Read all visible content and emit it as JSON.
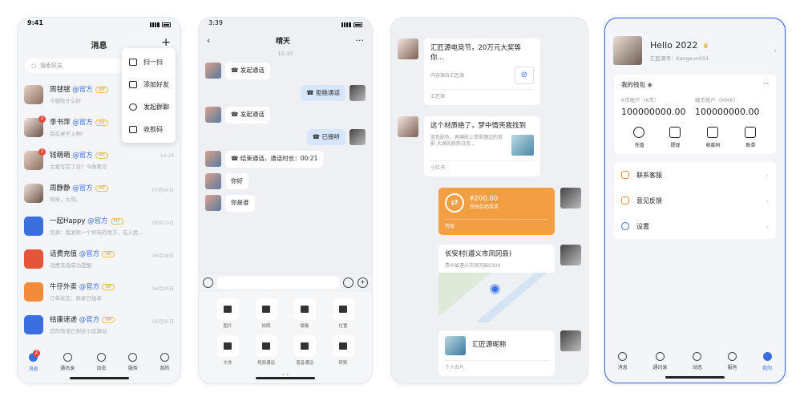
{
  "screen1": {
    "status_time": "9:41",
    "title": "消息",
    "search_placeholder": "搜索好友",
    "popup": [
      "扫一扫",
      "添加好友",
      "发起群聊",
      "收款码"
    ],
    "conversations": [
      {
        "name": "周毬毬",
        "official": "@官方",
        "vip": "VIP",
        "preview": "今晚吃什么好",
        "time": "",
        "badge": ""
      },
      {
        "name": "李书萍",
        "official": "@官方",
        "vip": "VIP",
        "preview": "我在桌子上啊！",
        "time": "",
        "badge": "2"
      },
      {
        "name": "钱萌萌",
        "official": "@官方",
        "vip": "VIP",
        "preview": "文案写完了没？今晚要交",
        "time": "14:18",
        "badge": "2"
      },
      {
        "name": "周静静",
        "official": "@官方",
        "vip": "VIP",
        "preview": "哈哈，大哥。",
        "time": "07月04日",
        "badge": ""
      },
      {
        "name": "一起Happy",
        "official": "@官方",
        "vip": "VIP",
        "preview": "信源：我发现一个好玩的地方，在人民...",
        "time": "06月10日",
        "badge": ""
      },
      {
        "name": "话费充值",
        "official": "@官方",
        "vip": "VIP",
        "preview": "话费充值成功提醒",
        "time": "06月08日",
        "badge": ""
      },
      {
        "name": "牛仔外卖",
        "official": "@官方",
        "vip": "VIP",
        "preview": "订单状态：商家已接单",
        "time": "06月28日",
        "badge": ""
      },
      {
        "name": "结康速递",
        "official": "@官方",
        "vip": "VIP",
        "preview": "您的快递已到达小区驿站",
        "time": "06月05日",
        "badge": ""
      }
    ],
    "tabs": [
      "消息",
      "通讯录",
      "动态",
      "服务",
      "我的"
    ],
    "tab_badge": "2"
  },
  "screen2": {
    "status_time": "3:39",
    "title": "晴天",
    "timestamp": "15:37",
    "messages": [
      {
        "side": "l",
        "text": "发起通话"
      },
      {
        "side": "r",
        "text": "拒绝通话"
      },
      {
        "side": "l",
        "text": "发起通话"
      },
      {
        "side": "r",
        "text": "已接听"
      },
      {
        "side": "l",
        "text": "结束通话，通话时长：00:21"
      },
      {
        "side": "l",
        "text": "你好"
      },
      {
        "side": "l",
        "text": "你是谁"
      }
    ],
    "tools": [
      "图片",
      "拍照",
      "摄像",
      "位置",
      "文件",
      "视频通话",
      "语音通话",
      "转账"
    ]
  },
  "screen3": {
    "card1_title": "汇匠源电竞节，20万元大奖等你...",
    "card1_sub": "内容源自汇匠源",
    "card1_foot": "汇匠源",
    "card2_title": "这个材质绝了，梦中情壳我找到",
    "card2_sub": "蓝色配色，再编配上翡翠镶边的背影 大满的质感日常...",
    "card2_foot": "小红书",
    "transfer_amount": "¥200.00",
    "transfer_note": "转账给杨笑笑",
    "transfer_foot": "转账",
    "location_title": "长安村(遵义市凤冈县)",
    "location_addr": "贵州省遵义市凤冈县S304",
    "contact_name": "汇匠源昵称",
    "contact_foot": "个人名片"
  },
  "screen4": {
    "greeting": "Hello 2022",
    "account": "汇匠源号：Kangxun001",
    "wallet_title": "我的钱包",
    "balances": [
      {
        "label": "K币账户（K币）",
        "value": "100000000.00"
      },
      {
        "label": "缅币账户（MMK）",
        "value": "100000000.00"
      }
    ],
    "actions": [
      "充值",
      "提现",
      "收款码",
      "账单"
    ],
    "menu": [
      "联系客服",
      "意见反馈",
      "设置"
    ],
    "tabs": [
      "消息",
      "通讯录",
      "动态",
      "服务",
      "我的"
    ]
  }
}
